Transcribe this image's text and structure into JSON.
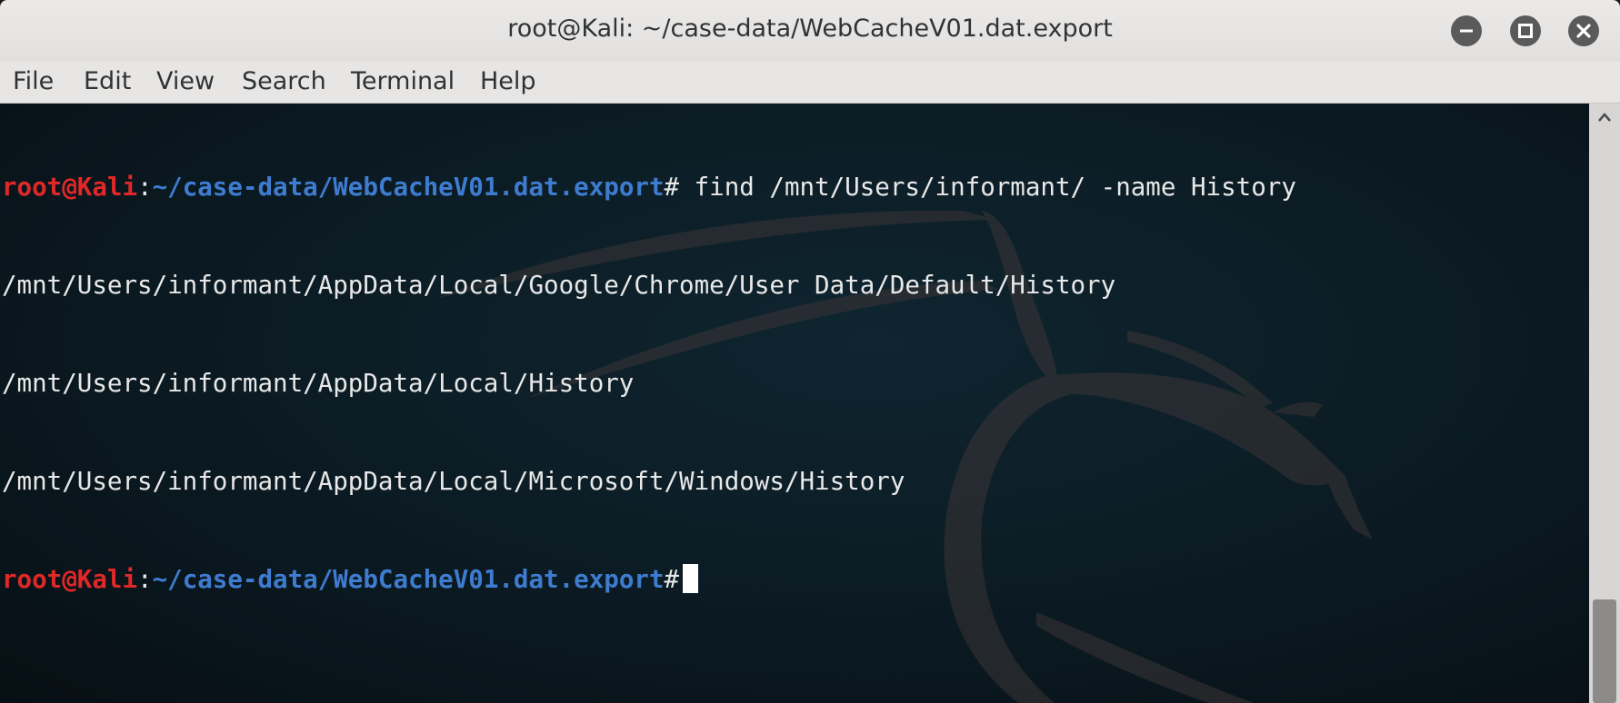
{
  "window": {
    "title": "root@Kali: ~/case-data/WebCacheV01.dat.export"
  },
  "menu": {
    "items": [
      "File",
      "Edit",
      "View",
      "Search",
      "Terminal",
      "Help"
    ]
  },
  "terminal": {
    "prompt_user": "root@Kali",
    "prompt_sep": ":",
    "prompt_path": "~/case-data/WebCacheV01.dat.export",
    "prompt_symbol": "#",
    "command": " find /mnt/Users/informant/ -name History",
    "output": [
      "/mnt/Users/informant/AppData/Local/Google/Chrome/User Data/Default/History",
      "/mnt/Users/informant/AppData/Local/History",
      "/mnt/Users/informant/AppData/Local/Microsoft/Windows/History"
    ]
  },
  "icons": {
    "minimize": "minimize-icon",
    "maximize": "maximize-icon",
    "close": "close-icon",
    "background": "kali-dragon-icon"
  },
  "colors": {
    "prompt_user": "#e02828",
    "prompt_path": "#3e7ccf",
    "terminal_bg": "#0b1a22"
  }
}
